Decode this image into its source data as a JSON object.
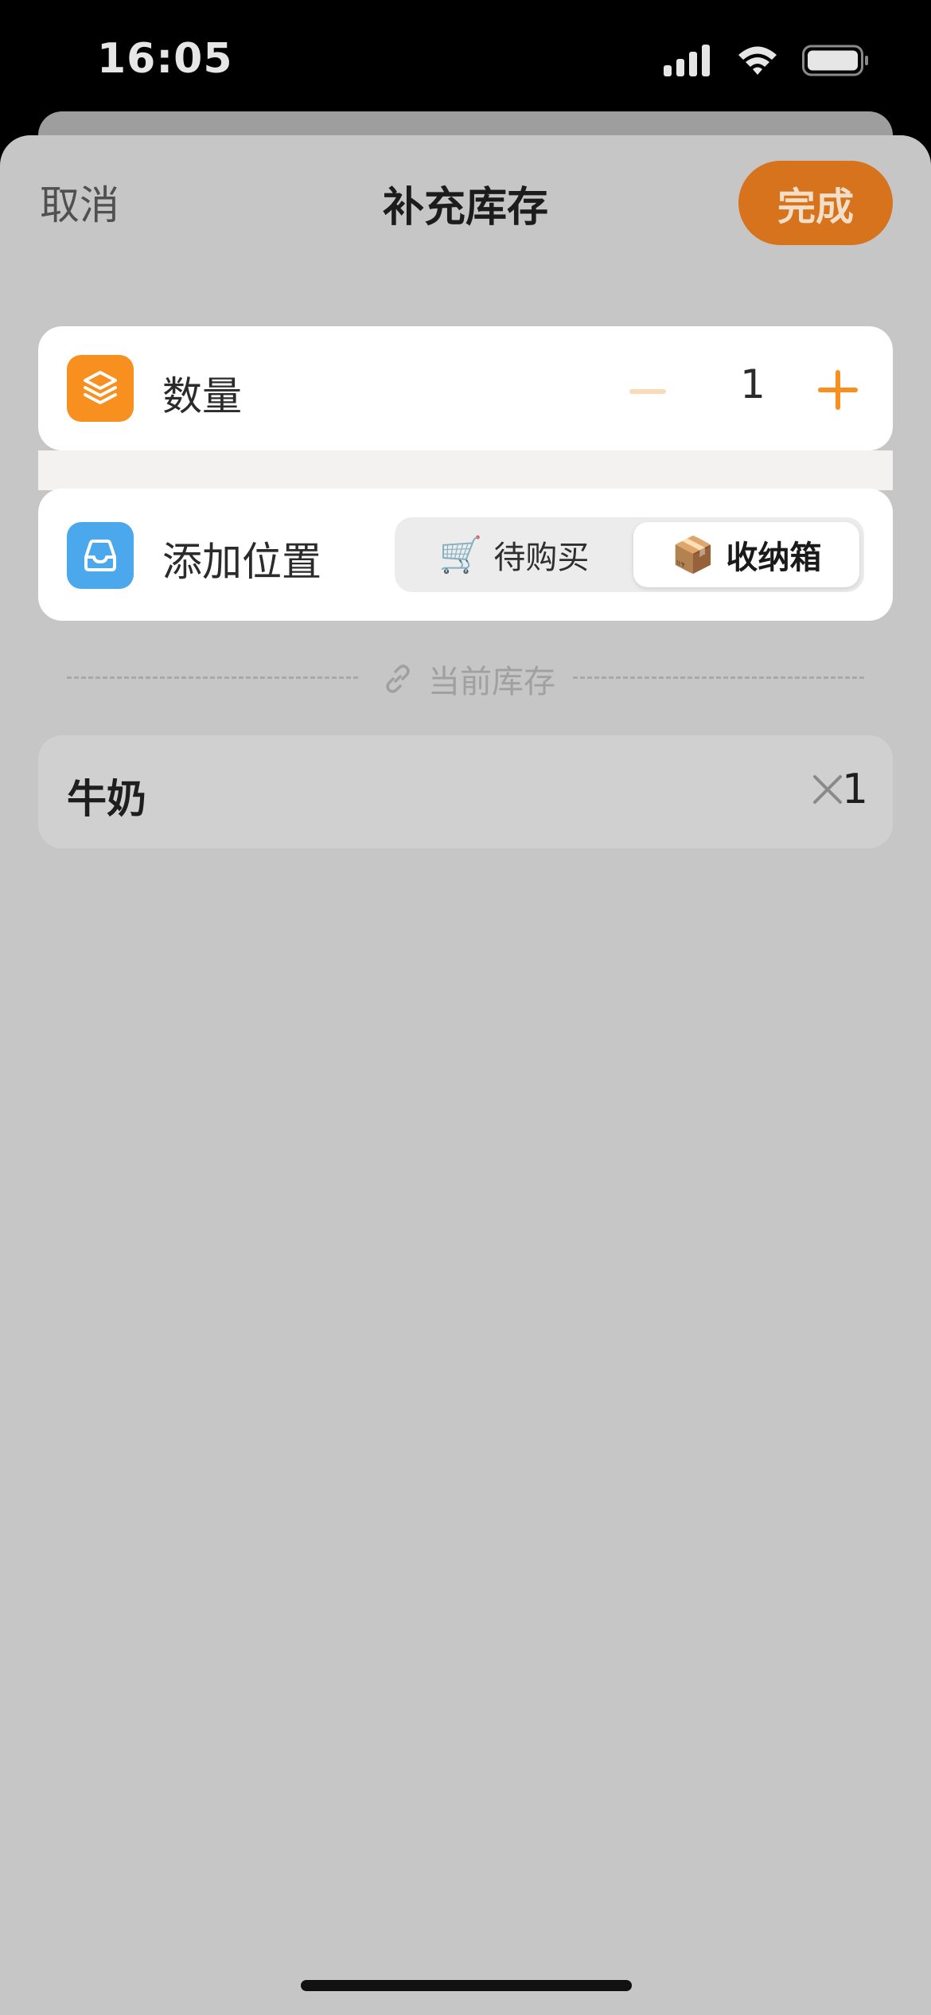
{
  "status_bar": {
    "time": "16:05",
    "icons": [
      "signal-icon",
      "wifi-icon",
      "battery-icon"
    ]
  },
  "nav": {
    "cancel_label": "取消",
    "title": "补充库存",
    "done_label": "完成"
  },
  "quantity_row": {
    "icon": "layers-icon",
    "label": "数量",
    "value": "1",
    "minus_icon": "minus-icon",
    "plus_icon": "plus-icon"
  },
  "location_row": {
    "icon": "tray-icon",
    "label": "添加位置",
    "options": [
      {
        "emoji": "🛒",
        "label": "待购买",
        "selected": false
      },
      {
        "emoji": "📦",
        "label": "收纳箱",
        "selected": true
      }
    ]
  },
  "current_stock": {
    "divider_icon": "link-icon",
    "label": "当前库存"
  },
  "stock_items": [
    {
      "name": "牛奶",
      "count": "1"
    }
  ],
  "colors": {
    "accent_orange": "#F7901E",
    "done_button": "#D6731C",
    "location_icon_blue": "#4BA8EC",
    "sheet_bg": "#C6C6C6"
  }
}
